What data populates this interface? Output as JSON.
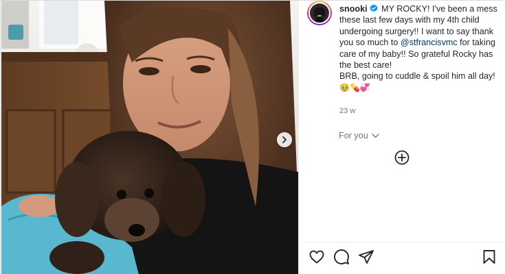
{
  "post": {
    "username": "snooki",
    "caption_line1": " MY ROCKY! I've been a mess these last few days with my 4th child undergoing surgery!! I want to say thank you so much to ",
    "mention": "@stfrancisvmc",
    "caption_line2": " for taking care of my baby!! So grateful Rocky has the best care!",
    "caption_line3": "BRB, going to cuddle & spoil him all day! ",
    "caption_emojis": "🥹💊💞",
    "timestamp": "23 w",
    "for_you_label": "For you"
  },
  "colors": {
    "link": "#00376b",
    "verified": "#0095f6",
    "muted": "#737373",
    "text": "#262626"
  },
  "icons": {
    "verified": "verified-badge-icon",
    "next": "chevron-right-icon",
    "expand": "chevron-down-icon",
    "add": "plus-circle-icon",
    "like": "heart-icon",
    "comment": "comment-icon",
    "share": "send-icon",
    "save": "bookmark-icon"
  }
}
